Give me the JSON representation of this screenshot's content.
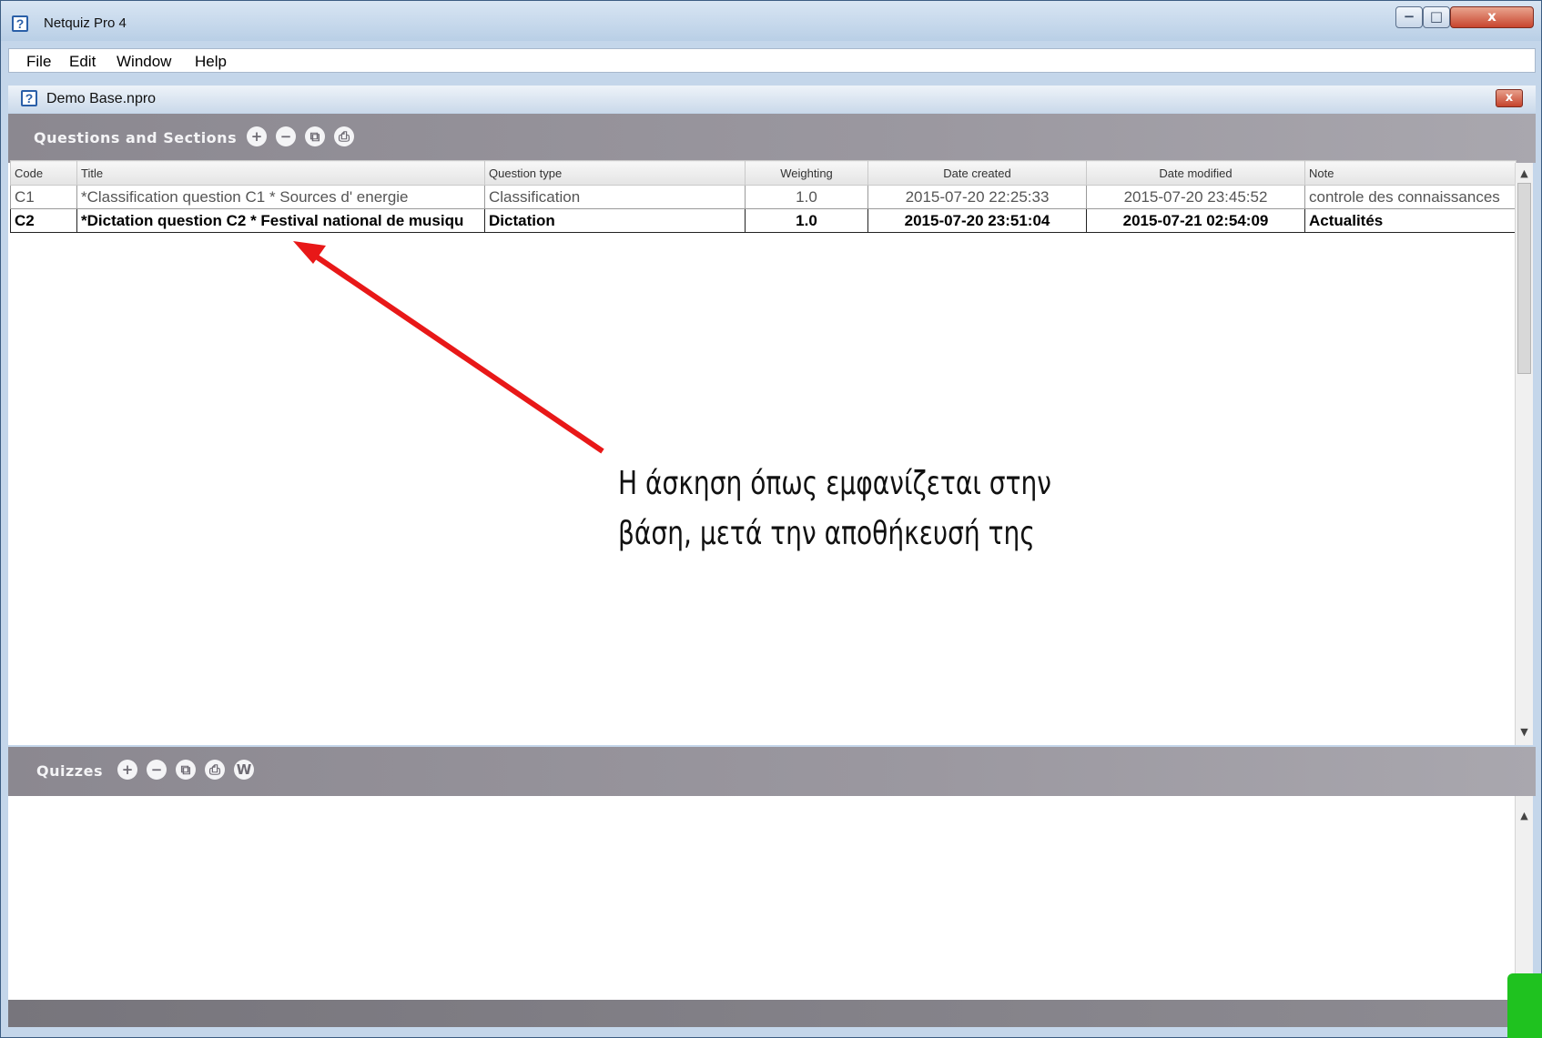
{
  "window": {
    "title": "Netquiz Pro 4",
    "min": "−",
    "max": "□",
    "close": "x"
  },
  "menu": [
    "File",
    "Edit",
    "Window",
    "Help"
  ],
  "document": {
    "title": "Demo Base.npro",
    "close": "x"
  },
  "questions": {
    "title": "Questions and Sections",
    "toolbar": [
      "+",
      "−",
      "⧉",
      "⎙"
    ],
    "columns": [
      "Code",
      "Title",
      "Question type",
      "Weighting",
      "Date created",
      "Date modified",
      "Note"
    ],
    "rows": [
      {
        "code": "C1",
        "title": "*Classification question C1 * Sources d' energie",
        "type": "Classification",
        "weighting": "1.0",
        "created": "2015-07-20 22:25:33",
        "modified": "2015-07-20 23:45:52",
        "note": "controle des connaissances"
      },
      {
        "code": "C2",
        "title": "*Dictation question C2 * Festival national de musiqu",
        "type": "Dictation",
        "weighting": "1.0",
        "created": "2015-07-20 23:51:04",
        "modified": "2015-07-21 02:54:09",
        "note": "Actualités"
      }
    ]
  },
  "quizzes": {
    "title": "Quizzes",
    "toolbar": [
      "+",
      "−",
      "⧉",
      "⎙",
      "W"
    ]
  },
  "annotation": {
    "line1": "Η άσκηση όπως εμφανίζεται στην",
    "line2": "βάση, μετά την αποθήκευσή της",
    "arrow_color": "#e81818"
  },
  "scroll": {
    "up": "▲",
    "down": "▼"
  }
}
